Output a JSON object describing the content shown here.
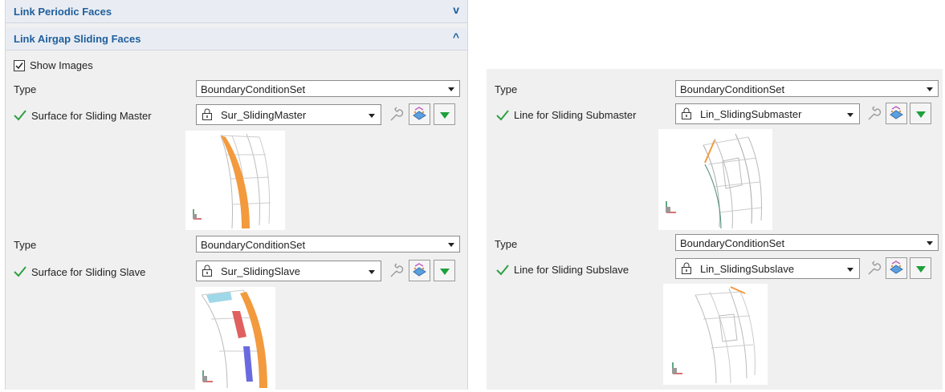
{
  "sections": {
    "periodic": {
      "title": "Link Periodic Faces",
      "chevron": "v"
    },
    "airgap": {
      "title": "Link Airgap Sliding Faces",
      "chevron": "^"
    }
  },
  "show_images": {
    "label": "Show Images",
    "checked": true
  },
  "left": {
    "master": {
      "type_label": "Type",
      "type_value": "BoundaryConditionSet",
      "field_label": "Surface for Sliding Master",
      "field_value": "Sur_SlidingMaster"
    },
    "slave": {
      "type_label": "Type",
      "type_value": "BoundaryConditionSet",
      "field_label": "Surface for Sliding Slave",
      "field_value": "Sur_SlidingSlave"
    }
  },
  "right": {
    "submaster": {
      "type_label": "Type",
      "type_value": "BoundaryConditionSet",
      "field_label": "Line for Sliding Submaster",
      "field_value": "Lin_SlidingSubmaster"
    },
    "subslave": {
      "type_label": "Type",
      "type_value": "BoundaryConditionSet",
      "field_label": "Line for Sliding Subslave",
      "field_value": "Lin_SlidingSubslave"
    }
  },
  "colors": {
    "accent": "#1f5e9c",
    "check": "#2ea043",
    "highlight": "#f29a3d",
    "slave_red": "#e06060",
    "slave_blue": "#6a6ae0"
  },
  "icons": [
    "lock-icon",
    "wrench-icon",
    "pick-icon",
    "dropdown-green-icon",
    "check-icon",
    "checkbox-icon",
    "axis-icon"
  ]
}
